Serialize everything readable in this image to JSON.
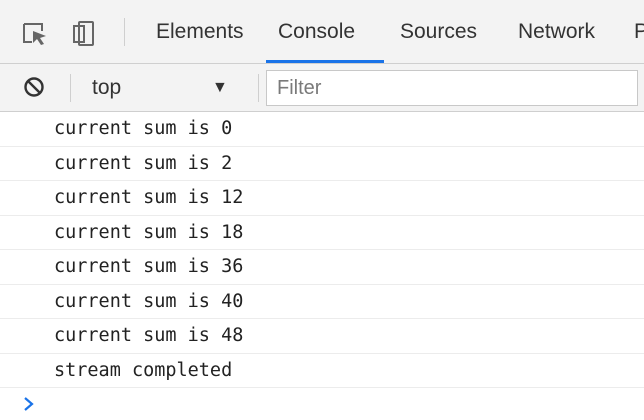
{
  "tabs": [
    {
      "label": "Elements"
    },
    {
      "label": "Console"
    },
    {
      "label": "Sources"
    },
    {
      "label": "Network"
    },
    {
      "label": "P"
    }
  ],
  "active_tab": "Console",
  "toolbar": {
    "context": "top",
    "filter_placeholder": "Filter",
    "filter_value": ""
  },
  "console_messages": [
    {
      "text": "current sum is 0"
    },
    {
      "text": "current sum is 2"
    },
    {
      "text": "current sum is 12"
    },
    {
      "text": "current sum is 18"
    },
    {
      "text": "current sum is 36"
    },
    {
      "text": "current sum is 40"
    },
    {
      "text": "current sum is 48"
    },
    {
      "text": "stream completed"
    }
  ],
  "icons": {
    "inspect": "inspect-element-icon",
    "device": "device-toolbar-icon",
    "clear": "clear-console-icon",
    "dropdown": "dropdown-arrow-icon",
    "prompt": "console-prompt-icon"
  },
  "colors": {
    "active_tab_underline": "#1a73e8",
    "prompt_caret": "#1a73e8"
  }
}
